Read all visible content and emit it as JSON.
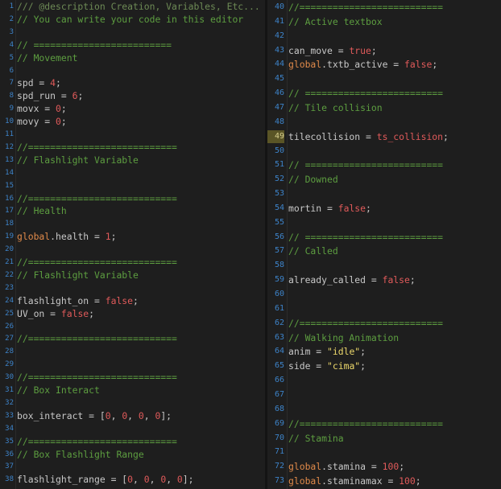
{
  "editor": {
    "left_pane": {
      "lines": [
        {
          "n": "1",
          "tokens": [
            {
              "t": "/// @description Creation, Variables, Etc...",
              "c": "cm-desc"
            }
          ]
        },
        {
          "n": "2",
          "tokens": [
            {
              "t": "// You can write your code in this editor",
              "c": "cm"
            }
          ]
        },
        {
          "n": "3",
          "tokens": []
        },
        {
          "n": "4",
          "tokens": [
            {
              "t": "// =========================",
              "c": "cm"
            }
          ]
        },
        {
          "n": "5",
          "tokens": [
            {
              "t": "// Movement",
              "c": "cm"
            }
          ]
        },
        {
          "n": "6",
          "tokens": []
        },
        {
          "n": "7",
          "tokens": [
            {
              "t": "spd",
              "c": "id"
            },
            {
              "t": " = ",
              "c": "op"
            },
            {
              "t": "4",
              "c": "num"
            },
            {
              "t": ";",
              "c": "op"
            }
          ]
        },
        {
          "n": "8",
          "tokens": [
            {
              "t": "spd_run",
              "c": "id"
            },
            {
              "t": " = ",
              "c": "op"
            },
            {
              "t": "6",
              "c": "num"
            },
            {
              "t": ";",
              "c": "op"
            }
          ]
        },
        {
          "n": "9",
          "tokens": [
            {
              "t": "movx",
              "c": "id"
            },
            {
              "t": " = ",
              "c": "op"
            },
            {
              "t": "0",
              "c": "num"
            },
            {
              "t": ";",
              "c": "op"
            }
          ]
        },
        {
          "n": "10",
          "tokens": [
            {
              "t": "movy",
              "c": "id"
            },
            {
              "t": " = ",
              "c": "op"
            },
            {
              "t": "0",
              "c": "num"
            },
            {
              "t": ";",
              "c": "op"
            }
          ]
        },
        {
          "n": "11",
          "tokens": []
        },
        {
          "n": "12",
          "tokens": [
            {
              "t": "//===========================",
              "c": "cm"
            }
          ]
        },
        {
          "n": "13",
          "tokens": [
            {
              "t": "// Flashlight Variable",
              "c": "cm"
            }
          ]
        },
        {
          "n": "14",
          "tokens": []
        },
        {
          "n": "15",
          "tokens": []
        },
        {
          "n": "16",
          "tokens": [
            {
              "t": "//===========================",
              "c": "cm"
            }
          ]
        },
        {
          "n": "17",
          "tokens": [
            {
              "t": "// Health",
              "c": "cm"
            }
          ]
        },
        {
          "n": "18",
          "tokens": []
        },
        {
          "n": "19",
          "tokens": [
            {
              "t": "global",
              "c": "gv"
            },
            {
              "t": ".health",
              "c": "id"
            },
            {
              "t": " = ",
              "c": "op"
            },
            {
              "t": "1",
              "c": "num"
            },
            {
              "t": ";",
              "c": "op"
            }
          ]
        },
        {
          "n": "20",
          "tokens": []
        },
        {
          "n": "21",
          "tokens": [
            {
              "t": "//===========================",
              "c": "cm"
            }
          ]
        },
        {
          "n": "22",
          "tokens": [
            {
              "t": "// Flashlight Variable",
              "c": "cm"
            }
          ]
        },
        {
          "n": "23",
          "tokens": []
        },
        {
          "n": "24",
          "tokens": [
            {
              "t": "flashlight_on",
              "c": "id"
            },
            {
              "t": " = ",
              "c": "op"
            },
            {
              "t": "false",
              "c": "bool"
            },
            {
              "t": ";",
              "c": "op"
            }
          ]
        },
        {
          "n": "25",
          "tokens": [
            {
              "t": "UV_on",
              "c": "id"
            },
            {
              "t": " = ",
              "c": "op"
            },
            {
              "t": "false",
              "c": "bool"
            },
            {
              "t": ";",
              "c": "op"
            }
          ]
        },
        {
          "n": "26",
          "tokens": []
        },
        {
          "n": "27",
          "tokens": [
            {
              "t": "//===========================",
              "c": "cm"
            }
          ]
        },
        {
          "n": "28",
          "tokens": []
        },
        {
          "n": "29",
          "tokens": []
        },
        {
          "n": "30",
          "tokens": [
            {
              "t": "//===========================",
              "c": "cm"
            }
          ]
        },
        {
          "n": "31",
          "tokens": [
            {
              "t": "// Box Interact",
              "c": "cm"
            }
          ]
        },
        {
          "n": "32",
          "tokens": []
        },
        {
          "n": "33",
          "tokens": [
            {
              "t": "box_interact",
              "c": "id"
            },
            {
              "t": " = [",
              "c": "op"
            },
            {
              "t": "0",
              "c": "num"
            },
            {
              "t": ", ",
              "c": "op"
            },
            {
              "t": "0",
              "c": "num"
            },
            {
              "t": ", ",
              "c": "op"
            },
            {
              "t": "0",
              "c": "num"
            },
            {
              "t": ", ",
              "c": "op"
            },
            {
              "t": "0",
              "c": "num"
            },
            {
              "t": "];",
              "c": "op"
            }
          ]
        },
        {
          "n": "34",
          "tokens": []
        },
        {
          "n": "35",
          "tokens": [
            {
              "t": "//===========================",
              "c": "cm"
            }
          ]
        },
        {
          "n": "36",
          "tokens": [
            {
              "t": "// Box Flashlight Range",
              "c": "cm"
            }
          ]
        },
        {
          "n": "37",
          "tokens": []
        },
        {
          "n": "38",
          "tokens": [
            {
              "t": "flashlight_range",
              "c": "id"
            },
            {
              "t": " = [",
              "c": "op"
            },
            {
              "t": "0",
              "c": "num"
            },
            {
              "t": ", ",
              "c": "op"
            },
            {
              "t": "0",
              "c": "num"
            },
            {
              "t": ", ",
              "c": "op"
            },
            {
              "t": "0",
              "c": "num"
            },
            {
              "t": ", ",
              "c": "op"
            },
            {
              "t": "0",
              "c": "num"
            },
            {
              "t": "];",
              "c": "op"
            }
          ]
        }
      ]
    },
    "right_pane": {
      "highlighted_line": "49",
      "lines": [
        {
          "n": "40",
          "tokens": [
            {
              "t": "//==========================",
              "c": "cm"
            }
          ]
        },
        {
          "n": "41",
          "tokens": [
            {
              "t": "// Active textbox",
              "c": "cm"
            }
          ]
        },
        {
          "n": "42",
          "tokens": []
        },
        {
          "n": "43",
          "tokens": [
            {
              "t": "can_move",
              "c": "id"
            },
            {
              "t": " = ",
              "c": "op"
            },
            {
              "t": "true",
              "c": "bool"
            },
            {
              "t": ";",
              "c": "op"
            }
          ]
        },
        {
          "n": "44",
          "tokens": [
            {
              "t": "global",
              "c": "gv"
            },
            {
              "t": ".txtb_active",
              "c": "id"
            },
            {
              "t": " = ",
              "c": "op"
            },
            {
              "t": "false",
              "c": "bool"
            },
            {
              "t": ";",
              "c": "op"
            }
          ]
        },
        {
          "n": "45",
          "tokens": []
        },
        {
          "n": "46",
          "tokens": [
            {
              "t": "// =========================",
              "c": "cm"
            }
          ]
        },
        {
          "n": "47",
          "tokens": [
            {
              "t": "// Tile collision",
              "c": "cm"
            }
          ]
        },
        {
          "n": "48",
          "tokens": []
        },
        {
          "n": "49",
          "tokens": [
            {
              "t": "tilecollision",
              "c": "id"
            },
            {
              "t": " = ",
              "c": "op"
            },
            {
              "t": "ts_collision",
              "c": "fn"
            },
            {
              "t": ";",
              "c": "op"
            }
          ]
        },
        {
          "n": "50",
          "tokens": []
        },
        {
          "n": "51",
          "tokens": [
            {
              "t": "// =========================",
              "c": "cm"
            }
          ]
        },
        {
          "n": "52",
          "tokens": [
            {
              "t": "// Downed",
              "c": "cm"
            }
          ]
        },
        {
          "n": "53",
          "tokens": []
        },
        {
          "n": "54",
          "tokens": [
            {
              "t": "mortin",
              "c": "id"
            },
            {
              "t": " = ",
              "c": "op"
            },
            {
              "t": "false",
              "c": "bool"
            },
            {
              "t": ";",
              "c": "op"
            }
          ]
        },
        {
          "n": "55",
          "tokens": []
        },
        {
          "n": "56",
          "tokens": [
            {
              "t": "// =========================",
              "c": "cm"
            }
          ]
        },
        {
          "n": "57",
          "tokens": [
            {
              "t": "// Called",
              "c": "cm"
            }
          ]
        },
        {
          "n": "58",
          "tokens": []
        },
        {
          "n": "59",
          "tokens": [
            {
              "t": "already_called",
              "c": "id"
            },
            {
              "t": " = ",
              "c": "op"
            },
            {
              "t": "false",
              "c": "bool"
            },
            {
              "t": ";",
              "c": "op"
            }
          ]
        },
        {
          "n": "60",
          "tokens": []
        },
        {
          "n": "61",
          "tokens": []
        },
        {
          "n": "62",
          "tokens": [
            {
              "t": "//==========================",
              "c": "cm"
            }
          ]
        },
        {
          "n": "63",
          "tokens": [
            {
              "t": "// Walking Animation",
              "c": "cm"
            }
          ]
        },
        {
          "n": "64",
          "tokens": [
            {
              "t": "anim",
              "c": "id"
            },
            {
              "t": " = ",
              "c": "op"
            },
            {
              "t": "\"idle\"",
              "c": "str"
            },
            {
              "t": ";",
              "c": "op"
            }
          ]
        },
        {
          "n": "65",
          "tokens": [
            {
              "t": "side",
              "c": "id"
            },
            {
              "t": " = ",
              "c": "op"
            },
            {
              "t": "\"cima\"",
              "c": "str"
            },
            {
              "t": ";",
              "c": "op"
            }
          ]
        },
        {
          "n": "66",
          "tokens": []
        },
        {
          "n": "67",
          "tokens": []
        },
        {
          "n": "68",
          "tokens": []
        },
        {
          "n": "69",
          "tokens": [
            {
              "t": "//==========================",
              "c": "cm"
            }
          ]
        },
        {
          "n": "70",
          "tokens": [
            {
              "t": "// Stamina",
              "c": "cm"
            }
          ]
        },
        {
          "n": "71",
          "tokens": []
        },
        {
          "n": "72",
          "tokens": [
            {
              "t": "global",
              "c": "gv"
            },
            {
              "t": ".stamina",
              "c": "id"
            },
            {
              "t": " = ",
              "c": "op"
            },
            {
              "t": "100",
              "c": "num"
            },
            {
              "t": ";",
              "c": "op"
            }
          ]
        },
        {
          "n": "73",
          "tokens": [
            {
              "t": "global",
              "c": "gv"
            },
            {
              "t": ".staminamax",
              "c": "id"
            },
            {
              "t": " = ",
              "c": "op"
            },
            {
              "t": "100",
              "c": "num"
            },
            {
              "t": ";",
              "c": "op"
            }
          ]
        }
      ]
    }
  },
  "colors": {
    "background": "#1e1e1e",
    "line_number": "#3d83c9",
    "comment": "#5d9e40",
    "keyword_global": "#e08a4a",
    "number": "#e05a5a",
    "string": "#ecd86b",
    "highlight_line": "#5a5526"
  }
}
